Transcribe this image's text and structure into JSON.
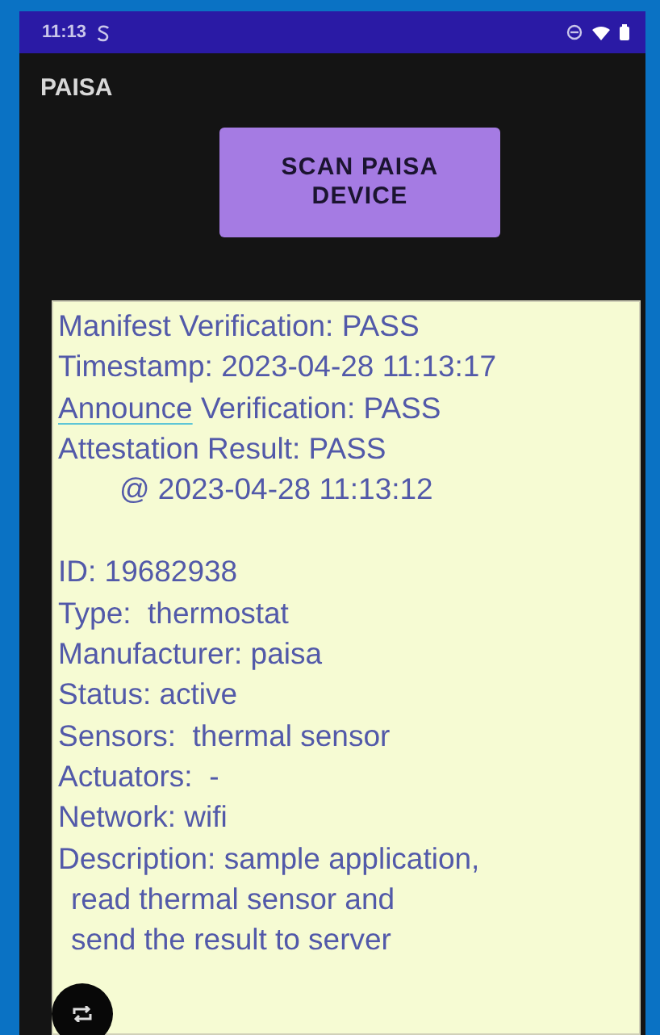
{
  "status_bar": {
    "time": "11:13"
  },
  "app_bar": {
    "title": "PAISA"
  },
  "scan_button": {
    "label": "SCAN PAISA\nDEVICE"
  },
  "result_lines": [
    {
      "kind": "line",
      "parts": [
        {
          "text": "Manifest Verification: PASS",
          "flagged": false
        }
      ]
    },
    {
      "kind": "line",
      "parts": [
        {
          "text": "Timestamp: 2023-04-28 11:13:17",
          "flagged": false
        }
      ]
    },
    {
      "kind": "line",
      "parts": [
        {
          "text": "Announce",
          "flagged": true
        },
        {
          "text": " Verification: PASS",
          "flagged": false
        }
      ]
    },
    {
      "kind": "line",
      "parts": [
        {
          "text": "Attestation Result: PASS",
          "flagged": false
        }
      ]
    },
    {
      "kind": "indented",
      "parts": [
        {
          "text": "@ 2023-04-28 11:13:12",
          "flagged": false
        }
      ]
    },
    {
      "kind": "gap"
    },
    {
      "kind": "line",
      "parts": [
        {
          "text": "ID: 19682938",
          "flagged": false
        }
      ]
    },
    {
      "kind": "line",
      "parts": [
        {
          "text": "Type:  thermostat",
          "flagged": false
        }
      ]
    },
    {
      "kind": "line",
      "parts": [
        {
          "text": "Manufacturer: paisa",
          "flagged": false
        }
      ]
    },
    {
      "kind": "line",
      "parts": [
        {
          "text": "Status: active",
          "flagged": false
        }
      ]
    },
    {
      "kind": "line",
      "parts": [
        {
          "text": "Sensors:  thermal sensor",
          "flagged": false
        }
      ]
    },
    {
      "kind": "line",
      "parts": [
        {
          "text": "Actuators:  -",
          "flagged": false
        }
      ]
    },
    {
      "kind": "line",
      "parts": [
        {
          "text": "Network: wifi",
          "flagged": false
        }
      ]
    },
    {
      "kind": "line",
      "parts": [
        {
          "text": "Description: sample application,",
          "flagged": false
        }
      ]
    },
    {
      "kind": "continued",
      "parts": [
        {
          "text": "read thermal sensor and",
          "flagged": false
        }
      ]
    },
    {
      "kind": "continued",
      "parts": [
        {
          "text": "send the result to server",
          "flagged": false
        }
      ]
    }
  ]
}
